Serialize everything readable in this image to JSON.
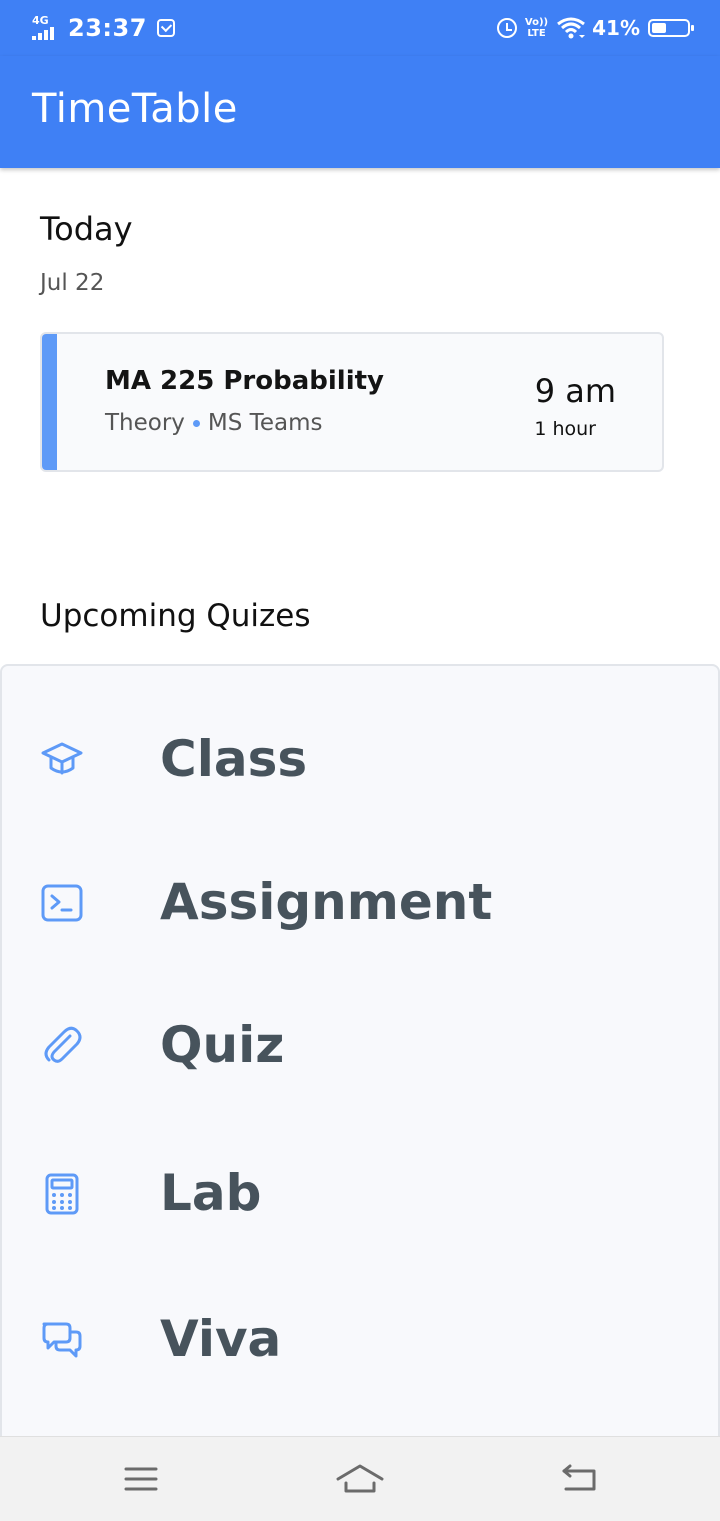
{
  "status_bar": {
    "network": "4G",
    "time": "23:37",
    "volte_top": "Vo))",
    "volte_bottom": "LTE",
    "battery_percent": "41%",
    "battery_level": 0.41
  },
  "app_bar": {
    "title": "TimeTable"
  },
  "today": {
    "heading": "Today",
    "date": "Jul 22",
    "classes": [
      {
        "title": "MA 225 Probability",
        "type": "Theory",
        "venue": "MS Teams",
        "time": "9 am",
        "duration": "1 hour"
      }
    ]
  },
  "upcoming": {
    "heading": "Upcoming Quizes",
    "items": [
      {
        "label": "Class",
        "icon": "graduation-cap-icon"
      },
      {
        "label": "Assignment",
        "icon": "terminal-icon"
      },
      {
        "label": "Quiz",
        "icon": "paperclip-icon"
      },
      {
        "label": "Lab",
        "icon": "calculator-icon"
      },
      {
        "label": "Viva",
        "icon": "chat-bubbles-icon"
      }
    ]
  },
  "colors": {
    "primary": "#3f80f5",
    "accent": "#5e9af7",
    "quiz_text": "#47535c",
    "panel_bg": "#f8f9fc"
  }
}
